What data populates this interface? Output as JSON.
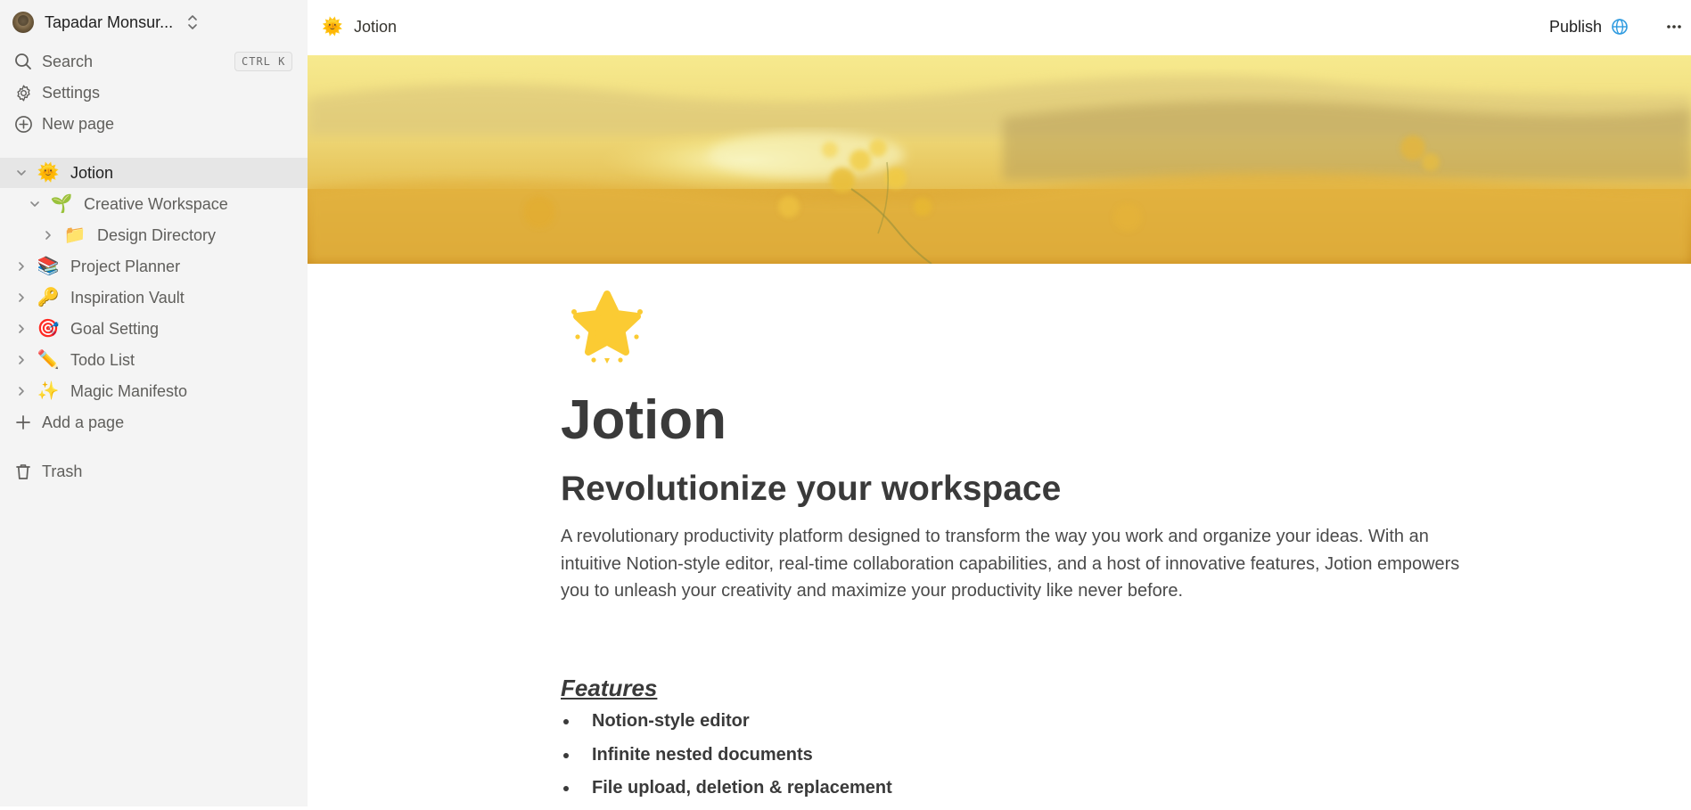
{
  "workspace": {
    "name": "Tapadar Monsur..."
  },
  "nav": {
    "search_label": "Search",
    "search_shortcut": "CTRL K",
    "settings_label": "Settings",
    "new_page_label": "New page",
    "add_page_label": "Add a page",
    "trash_label": "Trash"
  },
  "tree": [
    {
      "emoji": "🌞",
      "label": "Jotion",
      "expanded": true,
      "active": true,
      "depth": 0
    },
    {
      "emoji": "🌱",
      "label": "Creative Workspace",
      "expanded": true,
      "active": false,
      "depth": 1
    },
    {
      "emoji": "📁",
      "label": "Design Directory",
      "expanded": false,
      "active": false,
      "depth": 2
    },
    {
      "emoji": "📚",
      "label": "Project Planner",
      "expanded": false,
      "active": false,
      "depth": 0
    },
    {
      "emoji": "🔑",
      "label": "Inspiration Vault",
      "expanded": false,
      "active": false,
      "depth": 0
    },
    {
      "emoji": "🎯",
      "label": "Goal Setting",
      "expanded": false,
      "active": false,
      "depth": 0
    },
    {
      "emoji": "✏️",
      "label": "Todo List",
      "expanded": false,
      "active": false,
      "depth": 0
    },
    {
      "emoji": "✨",
      "label": "Magic Manifesto",
      "expanded": false,
      "active": false,
      "depth": 0
    }
  ],
  "topbar": {
    "crumb_emoji": "🌞",
    "crumb_label": "Jotion",
    "publish_label": "Publish"
  },
  "document": {
    "icon": "star-icon",
    "title": "Jotion",
    "heading": "Revolutionize your workspace",
    "paragraph": "A revolutionary productivity platform designed to transform the way you work and organize your ideas. With an intuitive Notion-style editor, real-time collaboration capabilities, and a host of innovative features, Jotion empowers you to unleash your creativity and maximize your productivity like never before.",
    "features_heading": "Features",
    "features": [
      "Notion-style editor",
      "Infinite nested documents",
      "File upload, deletion & replacement"
    ]
  },
  "colors": {
    "sidebar_bg": "#f4f4f4",
    "active_row_bg": "#e6e6e6",
    "globe_accent": "#2f9be0",
    "star_yellow": "#fbcb33"
  }
}
